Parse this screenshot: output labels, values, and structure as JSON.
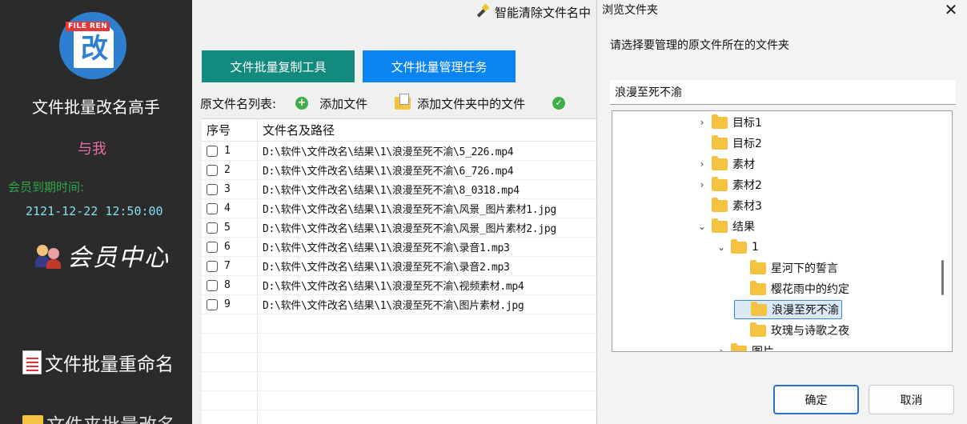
{
  "sidebar": {
    "logo_tag": "FILE REN",
    "logo_glyph": "改",
    "app_title": "文件批量改名高手",
    "user_name": "与我",
    "expire_label": "会员到期时间:",
    "expire_value": "2121-12-22 12:50:00",
    "member_center": "会员中心",
    "nav_rename": "文件批量重命名",
    "nav_folder": "文件夹批量改名"
  },
  "main": {
    "title": "智能清除文件名中",
    "btn_copy": "文件批量复制工具",
    "btn_manage": "文件批量管理任务",
    "list_label": "原文件名列表:",
    "add_file": "添加文件",
    "add_folder": "添加文件夹中的文件",
    "col_index": "序号",
    "col_path": "文件名及路径",
    "rows": [
      {
        "index": "1",
        "path": "D:\\软件\\文件改名\\结果\\1\\浪漫至死不渝\\5_226.mp4"
      },
      {
        "index": "2",
        "path": "D:\\软件\\文件改名\\结果\\1\\浪漫至死不渝\\6_726.mp4"
      },
      {
        "index": "3",
        "path": "D:\\软件\\文件改名\\结果\\1\\浪漫至死不渝\\8_0318.mp4"
      },
      {
        "index": "4",
        "path": "D:\\软件\\文件改名\\结果\\1\\浪漫至死不渝\\风景_图片素材1.jpg"
      },
      {
        "index": "5",
        "path": "D:\\软件\\文件改名\\结果\\1\\浪漫至死不渝\\风景_图片素材2.jpg"
      },
      {
        "index": "6",
        "path": "D:\\软件\\文件改名\\结果\\1\\浪漫至死不渝\\录音1.mp3"
      },
      {
        "index": "7",
        "path": "D:\\软件\\文件改名\\结果\\1\\浪漫至死不渝\\录音2.mp3"
      },
      {
        "index": "8",
        "path": "D:\\软件\\文件改名\\结果\\1\\浪漫至死不渝\\视频素材.mp4"
      },
      {
        "index": "9",
        "path": "D:\\软件\\文件改名\\结果\\1\\浪漫至死不渝\\图片素材.jpg"
      }
    ]
  },
  "dialog": {
    "title": "浏览文件夹",
    "close": "✕",
    "prompt": "请选择要管理的原文件所在的文件夹",
    "path_value": "浪漫至死不渝",
    "tree": [
      {
        "label": "目标1",
        "chevron": "›"
      },
      {
        "label": "目标2",
        "chevron": ""
      },
      {
        "label": "素材",
        "chevron": "›"
      },
      {
        "label": "素材2",
        "chevron": "›"
      },
      {
        "label": "素材3",
        "chevron": ""
      },
      {
        "label": "结果",
        "chevron": "⌄"
      },
      {
        "label": "1",
        "chevron": "⌄"
      },
      {
        "label": "星河下的誓言",
        "chevron": ""
      },
      {
        "label": "樱花雨中的约定",
        "chevron": ""
      },
      {
        "label": "浪漫至死不渝",
        "chevron": "",
        "selected": true
      },
      {
        "label": "玫瑰与诗歌之夜",
        "chevron": ""
      },
      {
        "label": "图片",
        "chevron": "›"
      }
    ],
    "ok": "确定",
    "cancel": "取消"
  }
}
